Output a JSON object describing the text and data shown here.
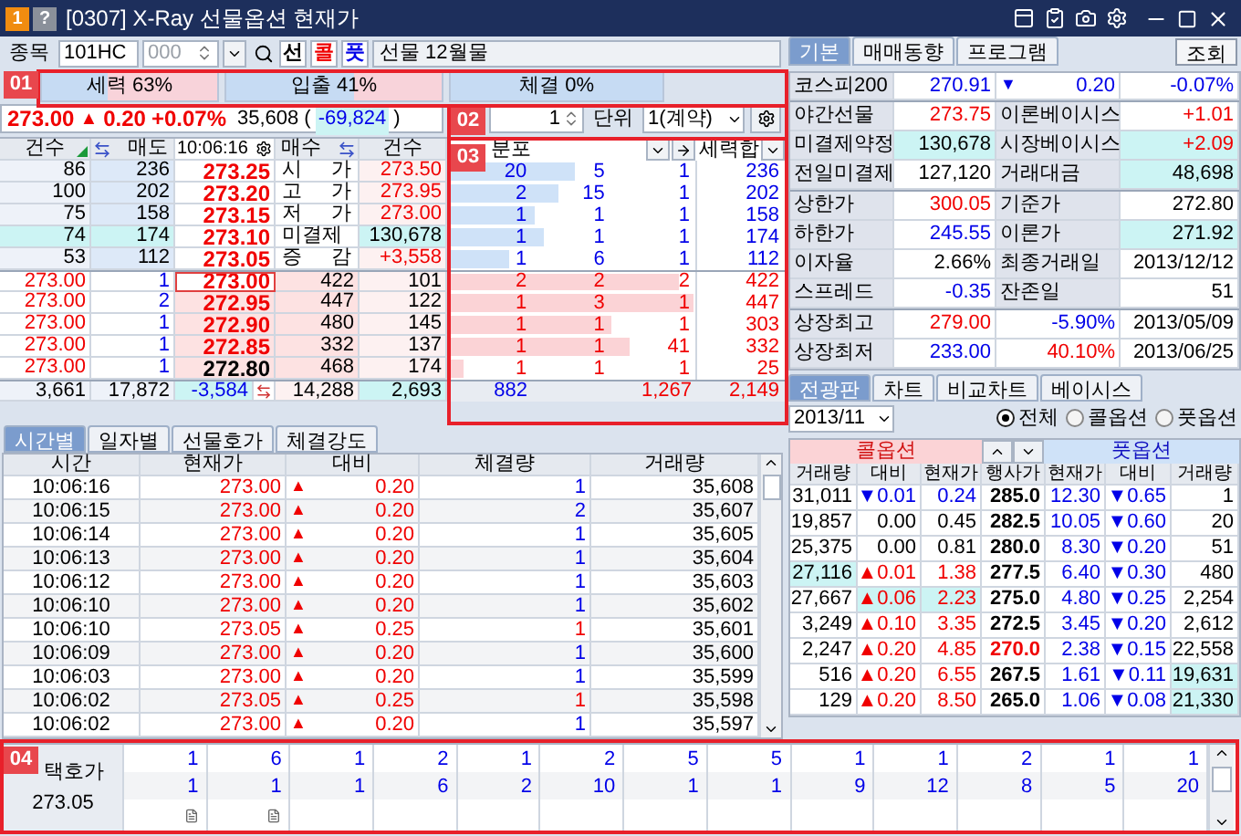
{
  "window": {
    "title": "[0307] X-Ray 선물옵션 현재가",
    "badges": [
      {
        "text": "1",
        "kind": "number"
      },
      {
        "text": "?",
        "kind": "help"
      }
    ]
  },
  "toolbar": {
    "label": "종목",
    "code": "101HC",
    "series": "000",
    "instrument_buttons": [
      {
        "text": "선",
        "color": "#000000"
      },
      {
        "text": "콜",
        "color": "#f00000"
      },
      {
        "text": "풋",
        "color": "#0000e8"
      }
    ],
    "instrument": "선물 12월물"
  },
  "callouts": [
    "01",
    "02",
    "03",
    "04"
  ],
  "gauges": [
    {
      "text": "세력 63%",
      "level": 0.37
    },
    {
      "text": "입출 41%",
      "level": 0.59
    },
    {
      "text": "체결 0%",
      "level": 1
    }
  ],
  "quote": {
    "price": "273.00",
    "arrow": "▲",
    "change": "0.20",
    "rate": "+0.07%",
    "color": "#f00000",
    "volume": "35,608",
    "open": "(",
    "volume_change": {
      "text": "-69,824",
      "color": "#0000e8"
    },
    "close": ")"
  },
  "unit_control": {
    "quantity": "1",
    "label": "단위",
    "unit": "1(계약)"
  },
  "orderbook": {
    "columns": [
      "건수",
      "매도",
      "10:06:16",
      "매수",
      "건수"
    ],
    "asks": [
      {
        "count": "86",
        "qty": "236",
        "price": "273.25",
        "color": "#f00000",
        "info": {
          "label": "시 가",
          "value": "273.50",
          "color": "#f00000"
        },
        "highlight": false
      },
      {
        "count": "100",
        "qty": "202",
        "price": "273.20",
        "color": "#f00000",
        "info": {
          "label": "고 가",
          "value": "273.95",
          "color": "#f00000"
        },
        "highlight": false
      },
      {
        "count": "75",
        "qty": "158",
        "price": "273.15",
        "color": "#f00000",
        "info": {
          "label": "저 가",
          "value": "273.00",
          "color": "#f00000"
        },
        "highlight": false
      },
      {
        "count": "74",
        "qty": "174",
        "price": "273.10",
        "color": "#f00000",
        "info": {
          "label": "미결제",
          "value": "130,678",
          "color": "#000000"
        },
        "highlight": true
      },
      {
        "count": "53",
        "qty": "112",
        "price": "273.05",
        "color": "#f00000",
        "info": {
          "label": "증 감",
          "value": "+3,558",
          "color": "#f00000"
        },
        "highlight": false
      }
    ],
    "bids": [
      {
        "last": "273.00",
        "last_qty": "1",
        "price": "273.00",
        "color": "#f00000",
        "qty": "422",
        "count": "101",
        "current": true
      },
      {
        "last": "273.00",
        "last_qty": "2",
        "price": "272.95",
        "color": "#f00000",
        "qty": "447",
        "count": "122",
        "current": false
      },
      {
        "last": "273.00",
        "last_qty": "1",
        "price": "272.90",
        "color": "#f00000",
        "qty": "480",
        "count": "145",
        "current": false
      },
      {
        "last": "273.00",
        "last_qty": "1",
        "price": "272.85",
        "color": "#f00000",
        "qty": "332",
        "count": "137",
        "current": false
      },
      {
        "last": "273.00",
        "last_qty": "1",
        "price": "272.80",
        "color": "#000000",
        "qty": "468",
        "count": "174",
        "current": false
      }
    ],
    "totals": {
      "ask_count": "3,661",
      "ask_qty": "17,872",
      "net": "-3,584",
      "bid_qty": "14,288",
      "bid_count": "2,693"
    }
  },
  "distribution": {
    "title": "분포",
    "sum_label": "세력합",
    "rows": [
      {
        "kind": "ask",
        "level": 0.51,
        "values": [
          "20",
          "5",
          "1"
        ],
        "sum": "236"
      },
      {
        "kind": "ask",
        "level": 0.44,
        "values": [
          "2",
          "15",
          "1"
        ],
        "sum": "202"
      },
      {
        "kind": "ask",
        "level": 0.34,
        "values": [
          "1",
          "1",
          "1"
        ],
        "sum": "158"
      },
      {
        "kind": "ask",
        "level": 0.38,
        "values": [
          "1",
          "1",
          "1"
        ],
        "sum": "174"
      },
      {
        "kind": "ask",
        "level": 0.24,
        "values": [
          "1",
          "6",
          "1"
        ],
        "sum": "112"
      },
      {
        "kind": "bid",
        "level": 0.93,
        "values": [
          "2",
          "2",
          "2"
        ],
        "sum": "422"
      },
      {
        "kind": "bid",
        "level": 0.99,
        "values": [
          "1",
          "3",
          "1"
        ],
        "sum": "447"
      },
      {
        "kind": "bid",
        "level": 0.66,
        "values": [
          "1",
          "1",
          "1"
        ],
        "sum": "303"
      },
      {
        "kind": "bid",
        "level": 0.73,
        "values": [
          "1",
          "1",
          "41"
        ],
        "sum": "332"
      },
      {
        "kind": "bid",
        "level": 0.05,
        "values": [
          "1",
          "1",
          "1"
        ],
        "sum": "25"
      }
    ],
    "totals": [
      {
        "text": "882",
        "color": "#0000e8"
      },
      {
        "text": "1,267",
        "color": "#f00000"
      },
      {
        "text": "2,149",
        "color": "#f00000"
      }
    ]
  },
  "trades": {
    "tabs": [
      {
        "label": "시간별",
        "selected": true
      },
      {
        "label": "일자별",
        "selected": false
      },
      {
        "label": "선물호가",
        "selected": false
      },
      {
        "label": "체결강도",
        "selected": false
      }
    ],
    "columns": [
      "시간",
      "현재가",
      "대비",
      "체결량",
      "거래량"
    ],
    "rows": [
      {
        "time": "10:06:16",
        "price": "273.00",
        "arrow": "▲",
        "change": "0.20",
        "color": "#f00000",
        "volume": {
          "text": "1",
          "color": "#0000e8"
        },
        "total": "35,608"
      },
      {
        "time": "10:06:15",
        "price": "273.00",
        "arrow": "▲",
        "change": "0.20",
        "color": "#f00000",
        "volume": {
          "text": "2",
          "color": "#0000e8"
        },
        "total": "35,607"
      },
      {
        "time": "10:06:14",
        "price": "273.00",
        "arrow": "▲",
        "change": "0.20",
        "color": "#f00000",
        "volume": {
          "text": "1",
          "color": "#0000e8"
        },
        "total": "35,605"
      },
      {
        "time": "10:06:13",
        "price": "273.00",
        "arrow": "▲",
        "change": "0.20",
        "color": "#f00000",
        "volume": {
          "text": "1",
          "color": "#0000e8"
        },
        "total": "35,604"
      },
      {
        "time": "10:06:12",
        "price": "273.00",
        "arrow": "▲",
        "change": "0.20",
        "color": "#f00000",
        "volume": {
          "text": "1",
          "color": "#0000e8"
        },
        "total": "35,603"
      },
      {
        "time": "10:06:10",
        "price": "273.00",
        "arrow": "▲",
        "change": "0.20",
        "color": "#f00000",
        "volume": {
          "text": "1",
          "color": "#0000e8"
        },
        "total": "35,602"
      },
      {
        "time": "10:06:10",
        "price": "273.05",
        "arrow": "▲",
        "change": "0.25",
        "color": "#f00000",
        "volume": {
          "text": "1",
          "color": "#f00000"
        },
        "total": "35,601"
      },
      {
        "time": "10:06:09",
        "price": "273.00",
        "arrow": "▲",
        "change": "0.20",
        "color": "#f00000",
        "volume": {
          "text": "1",
          "color": "#0000e8"
        },
        "total": "35,600"
      },
      {
        "time": "10:06:03",
        "price": "273.00",
        "arrow": "▲",
        "change": "0.20",
        "color": "#f00000",
        "volume": {
          "text": "1",
          "color": "#0000e8"
        },
        "total": "35,599"
      },
      {
        "time": "10:06:02",
        "price": "273.05",
        "arrow": "▲",
        "change": "0.25",
        "color": "#f00000",
        "volume": {
          "text": "1",
          "color": "#f00000"
        },
        "total": "35,598"
      },
      {
        "time": "10:06:02",
        "price": "273.00",
        "arrow": "▲",
        "change": "0.20",
        "color": "#f00000",
        "volume": {
          "text": "1",
          "color": "#0000e8"
        },
        "total": "35,597"
      }
    ]
  },
  "info": {
    "tabs": [
      {
        "label": "기본",
        "selected": true
      },
      {
        "label": "매매동향",
        "selected": false
      },
      {
        "label": "프로그램",
        "selected": false
      }
    ],
    "query_button": "조회",
    "index": {
      "label": "코스피200",
      "value": "270.91",
      "arrow": "▼",
      "change": "0.20",
      "rate": "-0.07%",
      "color": "#0000e8"
    },
    "groups": [
      [
        {
          "cells": [
            {
              "label": "야간선물",
              "value": "273.75",
              "color": "#f00000",
              "highlight": false
            },
            {
              "label": "이론베이시스",
              "value": "+1.01",
              "color": "#f00000",
              "highlight": false
            }
          ]
        },
        {
          "cells": [
            {
              "label": "미결제약정",
              "value": "130,678",
              "color": "#000000",
              "highlight": true
            },
            {
              "label": "시장베이시스",
              "value": "+2.09",
              "color": "#f00000",
              "highlight": true
            }
          ]
        },
        {
          "cells": [
            {
              "label": "전일미결제",
              "value": "127,120",
              "color": "#000000",
              "highlight": false
            },
            {
              "label": "거래대금",
              "value": "48,698",
              "color": "#000000",
              "highlight": true
            }
          ]
        }
      ],
      [
        {
          "cells": [
            {
              "label": "상한가",
              "value": "300.05",
              "color": "#f00000",
              "highlight": false
            },
            {
              "label": "기준가",
              "value": "272.80",
              "color": "#000000",
              "highlight": false
            }
          ]
        },
        {
          "cells": [
            {
              "label": "하한가",
              "value": "245.55",
              "color": "#0000e8",
              "highlight": false
            },
            {
              "label": "이론가",
              "value": "271.92",
              "color": "#000000",
              "highlight": true
            }
          ]
        },
        {
          "cells": [
            {
              "label": "이자율",
              "value": "2.66%",
              "color": "#000000",
              "highlight": false
            },
            {
              "label": "최종거래일",
              "value": "2013/12/12",
              "color": "#000000",
              "highlight": false
            }
          ]
        },
        {
          "cells": [
            {
              "label": "스프레드",
              "value": "-0.35",
              "color": "#0000e8",
              "highlight": false
            },
            {
              "label": "잔존일",
              "value": "51",
              "color": "#000000",
              "highlight": false
            }
          ]
        }
      ]
    ],
    "extremes": [
      {
        "label": "상장최고",
        "value": "279.00",
        "color": "#f00000",
        "rate": {
          "text": "-5.90%",
          "color": "#0000e8"
        },
        "date": "2013/05/09"
      },
      {
        "label": "상장최저",
        "value": "233.00",
        "color": "#0000e8",
        "rate": {
          "text": "40.10%",
          "color": "#f00000"
        },
        "date": "2013/06/25"
      }
    ]
  },
  "options": {
    "tabs": [
      {
        "label": "전광판",
        "selected": true
      },
      {
        "label": "차트",
        "selected": false
      },
      {
        "label": "비교차트",
        "selected": false
      },
      {
        "label": "베이시스",
        "selected": false
      }
    ],
    "month": "2013/11",
    "filters": [
      {
        "label": "전체",
        "selected": true
      },
      {
        "label": "콜옵션",
        "selected": false
      },
      {
        "label": "풋옵션",
        "selected": false
      }
    ],
    "call_title": "콜옵션",
    "put_title": "풋옵션",
    "columns": [
      "거래량",
      "대비",
      "현재가",
      "행사가",
      "현재가",
      "대비",
      "거래량"
    ],
    "rows": [
      {
        "cells": [
          {
            "text": "31,011",
            "color": "#000000",
            "highlight": false
          },
          {
            "text": "▼0.01",
            "color": "#0000e8",
            "highlight": false
          },
          {
            "text": "0.24",
            "color": "#0000e8",
            "highlight": false
          },
          {
            "text": "285.0",
            "color": "#000000",
            "highlight": false
          },
          {
            "text": "12.30",
            "color": "#0000e8",
            "highlight": false
          },
          {
            "text": "▼0.65",
            "color": "#0000e8",
            "highlight": false
          },
          {
            "text": "1",
            "color": "#000000",
            "highlight": false
          }
        ]
      },
      {
        "cells": [
          {
            "text": "19,857",
            "color": "#000000",
            "highlight": false
          },
          {
            "text": "0.00",
            "color": "#000000",
            "highlight": false
          },
          {
            "text": "0.45",
            "color": "#000000",
            "highlight": false
          },
          {
            "text": "282.5",
            "color": "#000000",
            "highlight": false
          },
          {
            "text": "10.05",
            "color": "#0000e8",
            "highlight": false
          },
          {
            "text": "▼0.60",
            "color": "#0000e8",
            "highlight": false
          },
          {
            "text": "20",
            "color": "#000000",
            "highlight": false
          }
        ]
      },
      {
        "cells": [
          {
            "text": "25,375",
            "color": "#000000",
            "highlight": false
          },
          {
            "text": "0.00",
            "color": "#000000",
            "highlight": false
          },
          {
            "text": "0.81",
            "color": "#000000",
            "highlight": false
          },
          {
            "text": "280.0",
            "color": "#000000",
            "highlight": false
          },
          {
            "text": "8.30",
            "color": "#0000e8",
            "highlight": false
          },
          {
            "text": "▼0.20",
            "color": "#0000e8",
            "highlight": false
          },
          {
            "text": "51",
            "color": "#000000",
            "highlight": false
          }
        ]
      },
      {
        "cells": [
          {
            "text": "27,116",
            "color": "#000000",
            "highlight": true
          },
          {
            "text": "▲0.01",
            "color": "#f00000",
            "highlight": false
          },
          {
            "text": "1.38",
            "color": "#f00000",
            "highlight": false
          },
          {
            "text": "277.5",
            "color": "#000000",
            "highlight": false
          },
          {
            "text": "6.40",
            "color": "#0000e8",
            "highlight": false
          },
          {
            "text": "▼0.30",
            "color": "#0000e8",
            "highlight": false
          },
          {
            "text": "480",
            "color": "#000000",
            "highlight": false
          }
        ]
      },
      {
        "cells": [
          {
            "text": "27,667",
            "color": "#000000",
            "highlight": false
          },
          {
            "text": "▲0.06",
            "color": "#f00000",
            "highlight": true
          },
          {
            "text": "2.23",
            "color": "#f00000",
            "highlight": true
          },
          {
            "text": "275.0",
            "color": "#000000",
            "highlight": false
          },
          {
            "text": "4.80",
            "color": "#0000e8",
            "highlight": false
          },
          {
            "text": "▼0.25",
            "color": "#0000e8",
            "highlight": false
          },
          {
            "text": "2,254",
            "color": "#000000",
            "highlight": false
          }
        ]
      },
      {
        "cells": [
          {
            "text": "3,249",
            "color": "#000000",
            "highlight": false
          },
          {
            "text": "▲0.10",
            "color": "#f00000",
            "highlight": false
          },
          {
            "text": "3.35",
            "color": "#f00000",
            "highlight": false
          },
          {
            "text": "272.5",
            "color": "#000000",
            "highlight": false
          },
          {
            "text": "3.45",
            "color": "#0000e8",
            "highlight": false
          },
          {
            "text": "▼0.20",
            "color": "#0000e8",
            "highlight": false
          },
          {
            "text": "2,612",
            "color": "#000000",
            "highlight": false
          }
        ]
      },
      {
        "cells": [
          {
            "text": "2,247",
            "color": "#000000",
            "highlight": false
          },
          {
            "text": "▲0.20",
            "color": "#f00000",
            "highlight": false
          },
          {
            "text": "4.85",
            "color": "#f00000",
            "highlight": false
          },
          {
            "text": "270.0",
            "color": "#f00000",
            "highlight": false
          },
          {
            "text": "2.38",
            "color": "#0000e8",
            "highlight": false
          },
          {
            "text": "▼0.15",
            "color": "#0000e8",
            "highlight": false
          },
          {
            "text": "22,558",
            "color": "#000000",
            "highlight": false
          }
        ]
      },
      {
        "cells": [
          {
            "text": "516",
            "color": "#000000",
            "highlight": false
          },
          {
            "text": "▲0.20",
            "color": "#f00000",
            "highlight": false
          },
          {
            "text": "6.55",
            "color": "#f00000",
            "highlight": false
          },
          {
            "text": "267.5",
            "color": "#000000",
            "highlight": false
          },
          {
            "text": "1.61",
            "color": "#0000e8",
            "highlight": false
          },
          {
            "text": "▼0.11",
            "color": "#0000e8",
            "highlight": false
          },
          {
            "text": "19,631",
            "color": "#000000",
            "highlight": true
          }
        ]
      },
      {
        "cells": [
          {
            "text": "129",
            "color": "#000000",
            "highlight": false
          },
          {
            "text": "▲0.20",
            "color": "#f00000",
            "highlight": false
          },
          {
            "text": "8.50",
            "color": "#f00000",
            "highlight": false
          },
          {
            "text": "265.0",
            "color": "#000000",
            "highlight": false
          },
          {
            "text": "1.06",
            "color": "#0000e8",
            "highlight": false
          },
          {
            "text": "▼0.08",
            "color": "#0000e8",
            "highlight": false
          },
          {
            "text": "21,330",
            "color": "#000000",
            "highlight": true
          }
        ]
      }
    ]
  },
  "selected_quote": {
    "label": "택호가",
    "price": "273.05",
    "rows": [
      [
        "1",
        "6",
        "1",
        "2",
        "1",
        "2",
        "5",
        "5",
        "1",
        "1",
        "2",
        "1",
        "1"
      ],
      [
        "1",
        "1",
        "1",
        "6",
        "2",
        "10",
        "1",
        "1",
        "9",
        "12",
        "8",
        "5",
        "20"
      ]
    ]
  }
}
